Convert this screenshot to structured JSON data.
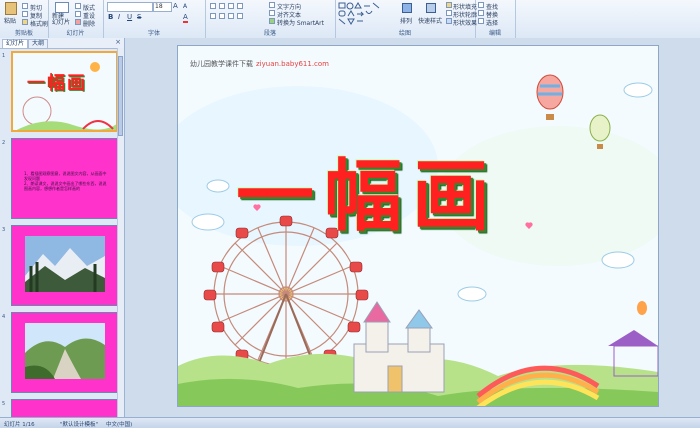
{
  "ribbon": {
    "groups": [
      {
        "label": "剪贴板"
      },
      {
        "label": "幻灯片"
      },
      {
        "label": "字体"
      },
      {
        "label": "段落"
      },
      {
        "label": "绘图"
      },
      {
        "label": "编辑"
      }
    ],
    "paste_label": "粘贴",
    "cut_label": "剪切",
    "copy_label": "复制",
    "format_painter_label": "格式刷",
    "new_slide_label": "新建\n幻灯片",
    "layout_label": "版式",
    "reset_label": "重设",
    "delete_label": "删除",
    "font_size_value": "18",
    "text_direction_label": "文字方向",
    "align_text_label": "对齐文本",
    "smartart_label": "转换为 SmartArt",
    "arrange_label": "排列",
    "quick_styles_label": "快速样式",
    "shape_fill_label": "形状填充",
    "shape_outline_label": "形状轮廓",
    "shape_effects_label": "形状效果",
    "find_label": "查找",
    "replace_label": "替换",
    "select_label": "选择"
  },
  "left_panel": {
    "tabs": [
      "幻灯片",
      "大纲"
    ],
    "slides": [
      {
        "number": "1",
        "title": "一幅画"
      },
      {
        "number": "2",
        "text": "1、看插图观察图意，说说图文内容，从画面中发现问题\n2、朗读课文，说说文中画出了哪些东西，说说图画内容，想想作者是怎样画的"
      },
      {
        "number": "3"
      },
      {
        "number": "4"
      },
      {
        "number": "5"
      }
    ]
  },
  "slide": {
    "title": "一幅画",
    "watermark_text": "幼儿园教学课件下载",
    "watermark_url": "ziyuan.baby611.com"
  },
  "status": {
    "slide_count": "幻灯片 1/16",
    "theme": "\"默认设计模板\"",
    "language": "中文(中国)"
  },
  "colors": {
    "title_red": "#ff2020",
    "title_shadow": "#2f8a2f",
    "thumb_magenta": "#ff33cc"
  }
}
